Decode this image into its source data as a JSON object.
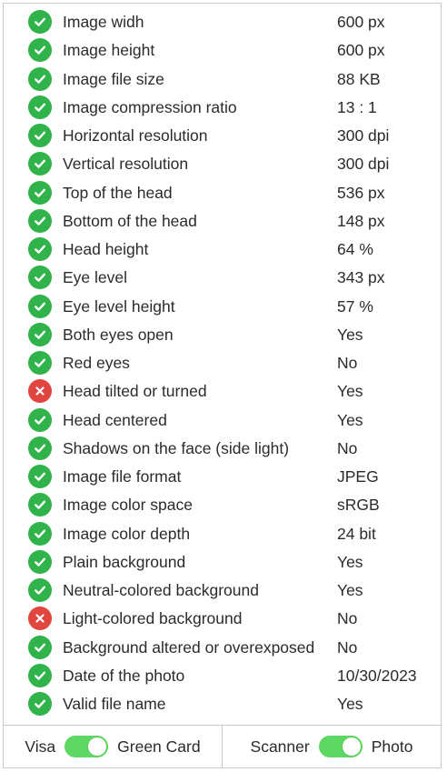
{
  "checks": [
    {
      "label": "Image widh",
      "value": "600 px",
      "status": "pass"
    },
    {
      "label": "Image height",
      "value": "600 px",
      "status": "pass"
    },
    {
      "label": "Image file size",
      "value": "88 KB",
      "status": "pass"
    },
    {
      "label": "Image compression ratio",
      "value": "13 : 1",
      "status": "pass"
    },
    {
      "label": "Horizontal resolution",
      "value": "300 dpi",
      "status": "pass"
    },
    {
      "label": "Vertical resolution",
      "value": "300 dpi",
      "status": "pass"
    },
    {
      "label": "Top of the head",
      "value": "536 px",
      "status": "pass"
    },
    {
      "label": "Bottom of the head",
      "value": "148 px",
      "status": "pass"
    },
    {
      "label": "Head height",
      "value": "64 %",
      "status": "pass"
    },
    {
      "label": "Eye level",
      "value": "343 px",
      "status": "pass"
    },
    {
      "label": "Eye level height",
      "value": "57 %",
      "status": "pass"
    },
    {
      "label": "Both eyes open",
      "value": "Yes",
      "status": "pass"
    },
    {
      "label": "Red eyes",
      "value": "No",
      "status": "pass"
    },
    {
      "label": "Head tilted or turned",
      "value": "Yes",
      "status": "fail"
    },
    {
      "label": "Head centered",
      "value": "Yes",
      "status": "pass"
    },
    {
      "label": "Shadows on the face (side light)",
      "value": "No",
      "status": "pass"
    },
    {
      "label": "Image file format",
      "value": "JPEG",
      "status": "pass"
    },
    {
      "label": "Image color space",
      "value": "sRGB",
      "status": "pass"
    },
    {
      "label": "Image color depth",
      "value": "24 bit",
      "status": "pass"
    },
    {
      "label": "Plain background",
      "value": "Yes",
      "status": "pass"
    },
    {
      "label": "Neutral-colored background",
      "value": "Yes",
      "status": "pass"
    },
    {
      "label": "Light-colored background",
      "value": "No",
      "status": "fail"
    },
    {
      "label": "Background altered or overexposed",
      "value": "No",
      "status": "pass"
    },
    {
      "label": "Date of the photo",
      "value": "10/30/2023",
      "status": "pass"
    },
    {
      "label": "Valid file name",
      "value": "Yes",
      "status": "pass"
    }
  ],
  "footer": {
    "left": {
      "off_label": "Visa",
      "on_label": "Green Card",
      "state": "on"
    },
    "right": {
      "off_label": "Scanner",
      "on_label": "Photo",
      "state": "on"
    }
  },
  "colors": {
    "pass": "#2fb34a",
    "fail": "#e0463f",
    "toggle_on": "#5dd862"
  },
  "icons": {
    "pass": "check-circle-icon",
    "fail": "x-circle-icon"
  }
}
